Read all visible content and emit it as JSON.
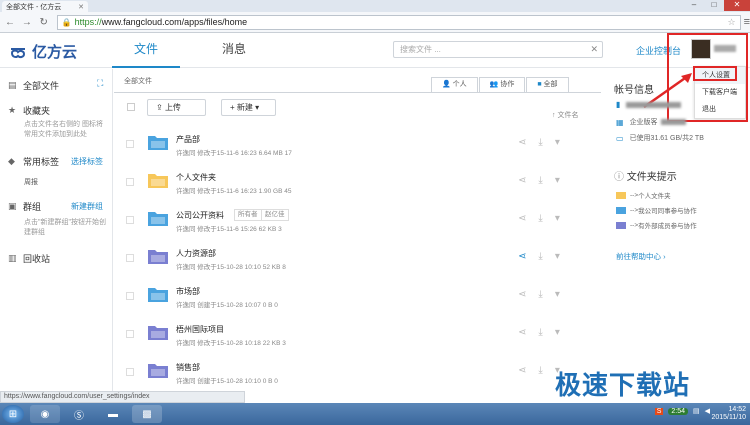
{
  "browser": {
    "tab_title": "全部文件 - 亿方云",
    "url_scheme": "https://",
    "url_rest": "www.fangcloud.com/apps/files/home",
    "status_url": "https://www.fangcloud.com/user_settings/index"
  },
  "header": {
    "logo_text": "亿方云",
    "nav_files": "文件",
    "nav_messages": "消息",
    "search_placeholder": "搜索文件 ...",
    "enterprise_link": "企业控制台"
  },
  "dropdown": {
    "items": [
      "个人设置",
      "下载客户端",
      "退出"
    ]
  },
  "sidebar": {
    "all_files": "全部文件",
    "favorites": "收藏夹",
    "favorites_note": "点击文件名右侧的 图标将常用文件添加到此处",
    "common_tags": "常用标签",
    "select_tags": "选择标签",
    "tag_item": "周报",
    "groups": "群组",
    "new_group": "新建群组",
    "groups_note": "点击\"新建群组\"按钮开始创建群组",
    "recycle": "回收站"
  },
  "main": {
    "breadcrumb": "全部文件",
    "view_tabs": [
      "个人",
      "协作",
      "全部"
    ],
    "upload_label": "上传",
    "new_label": "新建",
    "sort_label": "文件名",
    "rows": [
      {
        "name": "产品部",
        "meta": "许逸同   修改于15-11-6 16:23   6.64 MB   17",
        "color": "#4aa3df"
      },
      {
        "name": "个人文件夹",
        "meta": "许逸同   修改于15-11-6 16:23   1.90 GB   45",
        "color": "#f7c75a"
      },
      {
        "name": "公司公开资料",
        "meta": "许逸同   修改于15-11-6 15:26   62 KB   3",
        "tags": [
          "所有者",
          "赵亿佳"
        ],
        "color": "#4aa3df"
      },
      {
        "name": "人力资源部",
        "meta": "许逸同   修改于15-10-28 10:10   52 KB   8",
        "color": "#7a7fd1",
        "shared": true
      },
      {
        "name": "市场部",
        "meta": "许逸同   创建于15-10-28 10:07   0 B   0",
        "color": "#4aa3df"
      },
      {
        "name": "梧州国际项目",
        "meta": "许逸同   修改于15-10-28 10:18   22 KB   3",
        "color": "#7a7fd1"
      },
      {
        "name": "销售部",
        "meta": "许逸同   创建于15-10-28 10:10   0 B   0",
        "color": "#7a7fd1"
      }
    ]
  },
  "right_panel": {
    "account_title": "帐号信息",
    "enterprise_line": "企业版客",
    "quota": "已使用31.61 GB/共2 TB",
    "tips_title": "文件夹提示",
    "legend": [
      "个人文件夹",
      "我公司同事参与协作",
      "有外部成员参与协作"
    ],
    "help_link": "前往帮助中心"
  },
  "taskbar": {
    "clock_time": "14:52",
    "clock_date": "2015/11/10",
    "tray_badge": "2:54"
  },
  "watermark": "极速下载站"
}
